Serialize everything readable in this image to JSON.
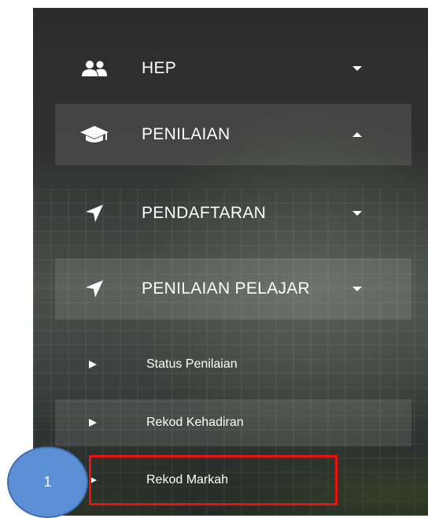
{
  "menu": {
    "items": [
      {
        "label": "HEP",
        "icon": "users-icon",
        "caret": "down"
      },
      {
        "label": "PENILAIAN",
        "icon": "graduation-cap-icon",
        "caret": "up"
      },
      {
        "label": "PENDAFTARAN",
        "icon": "location-arrow-icon",
        "caret": "down"
      },
      {
        "label": "PENILAIAN PELAJAR",
        "icon": "location-arrow-icon",
        "caret": "down"
      }
    ],
    "sub_items": [
      {
        "label": "Status Penilaian"
      },
      {
        "label": "Rekod Kehadiran"
      },
      {
        "label": "Rekod Markah"
      }
    ]
  },
  "annotation": {
    "step_number": "1",
    "highlight_color": "#ee1111",
    "badge_color": "#5b8fd6"
  }
}
